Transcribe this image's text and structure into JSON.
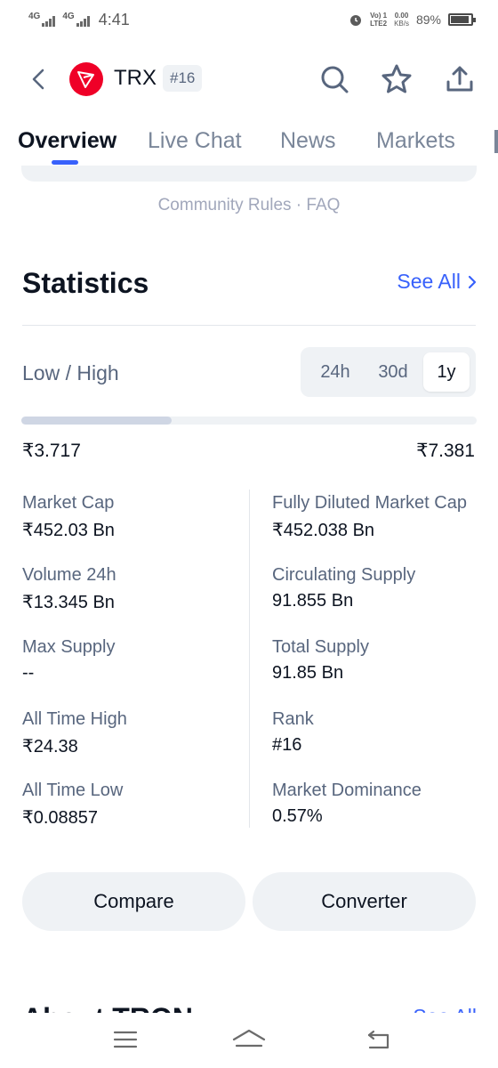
{
  "status_bar": {
    "network_1": "4G",
    "network_2": "4G",
    "time": "4:41",
    "volte": "Vo) 1",
    "lte": "LTE2",
    "speed_value": "0.00",
    "speed_unit": "KB/s",
    "battery": "89%",
    "battery_level": 0.89
  },
  "header": {
    "symbol": "TRX",
    "rank": "#16",
    "icons": [
      "back-icon",
      "tron-logo",
      "search-icon",
      "star-icon",
      "share-icon"
    ]
  },
  "tabs": [
    "Overview",
    "Live Chat",
    "News",
    "Markets"
  ],
  "community_links": "Community Rules · FAQ",
  "statistics": {
    "title": "Statistics",
    "see_all": "See All",
    "low_high_label": "Low / High",
    "periods": [
      "24h",
      "30d",
      "1y"
    ],
    "active_period": "1y",
    "low": "₹3.717",
    "high": "₹7.381",
    "range_position": 0.33,
    "left_column": [
      {
        "label": "Market Cap",
        "value": "₹452.03 Bn"
      },
      {
        "label": "Volume 24h",
        "value": "₹13.345 Bn"
      },
      {
        "label": "Max Supply",
        "value": "--"
      },
      {
        "label": "All Time High",
        "value": "₹24.38"
      },
      {
        "label": "All Time Low",
        "value": "₹0.08857"
      }
    ],
    "right_column": [
      {
        "label": "Fully Diluted Market Cap",
        "value": "₹452.038 Bn"
      },
      {
        "label": "Circulating Supply",
        "value": "91.855 Bn"
      },
      {
        "label": "Total Supply",
        "value": "91.85 Bn"
      },
      {
        "label": "Rank",
        "value": "#16"
      },
      {
        "label": "Market Dominance",
        "value": "0.57%"
      }
    ]
  },
  "buttons": {
    "compare": "Compare",
    "converter": "Converter"
  },
  "about": {
    "title": "About TRON",
    "see_all": "See All"
  },
  "nav_bar": [
    "menu-icon",
    "home-icon",
    "back-nav-icon"
  ],
  "colors": {
    "accent": "#3861fb",
    "tron_red": "#ef0027",
    "muted_text": "#58667e",
    "chip_bg": "#eff2f5"
  }
}
